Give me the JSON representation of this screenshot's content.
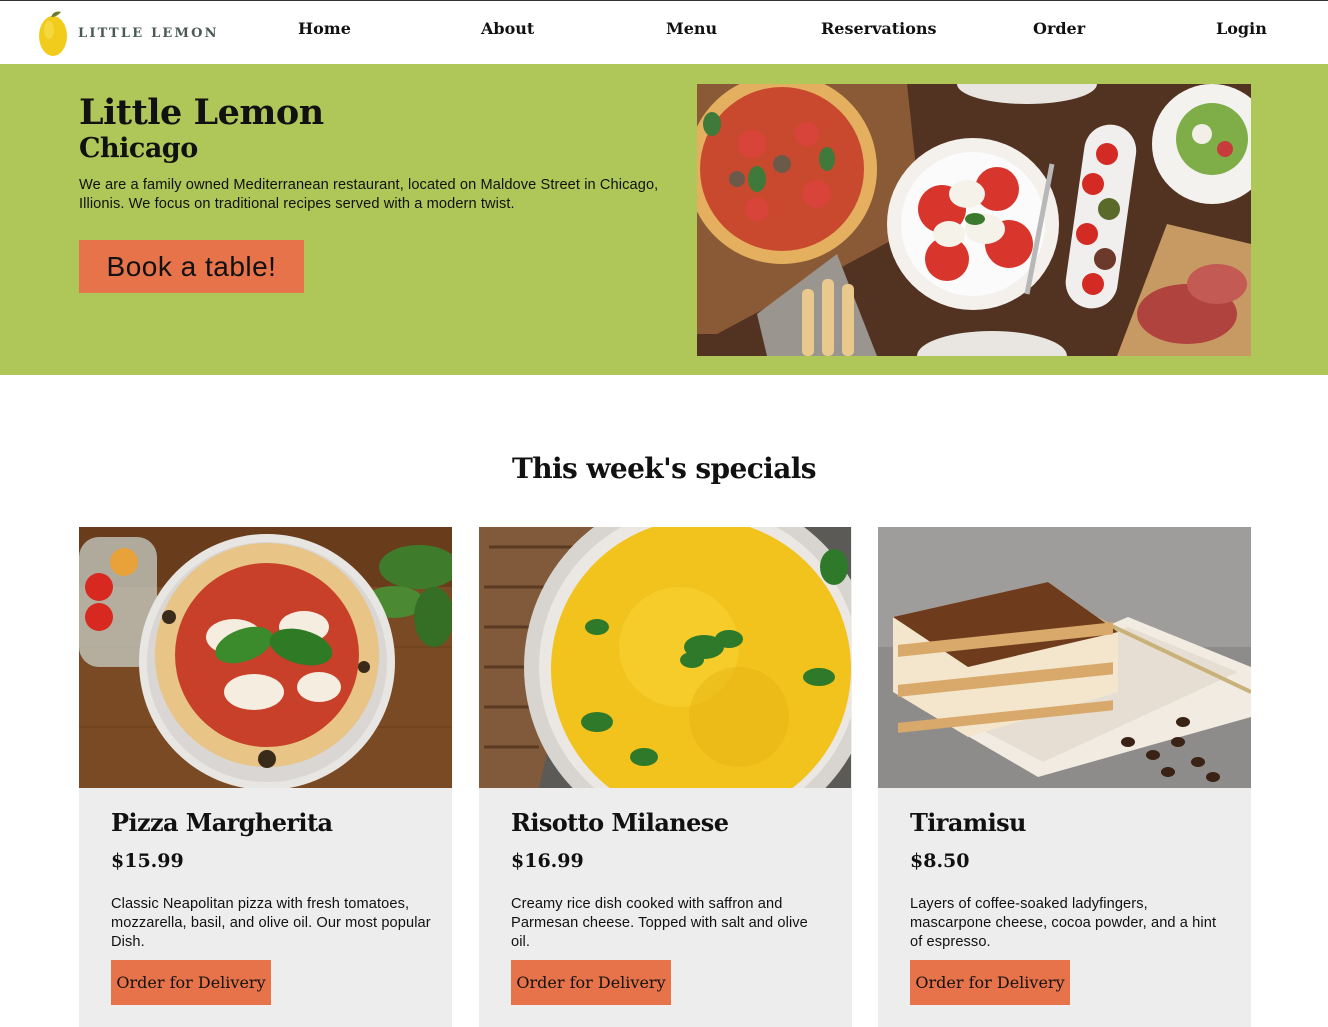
{
  "brand": {
    "logo_text": "LITTLE LEMON",
    "logo_alt": "Little Lemon logo"
  },
  "nav": {
    "items": [
      {
        "label": "Home"
      },
      {
        "label": "About"
      },
      {
        "label": "Menu"
      },
      {
        "label": "Reservations"
      },
      {
        "label": "Order"
      },
      {
        "label": "Login"
      }
    ]
  },
  "hero": {
    "title": "Little Lemon",
    "subtitle": "Chicago",
    "description": "We are a family owned Mediterranean restaurant, located on Maldove Street in Chicago, Illionis. We focus on traditional recipes served with a modern twist.",
    "button_label": "Book a table!",
    "image_alt": "Table with pizza, caprese salad, tomatoes and prosciutto"
  },
  "specials": {
    "title": "This week's specials",
    "cards": [
      {
        "name": "Pizza Margherita",
        "price": "$15.99",
        "description": "Classic Neapolitan pizza with fresh tomatoes, mozzarella, basil, and olive oil. Our most popular Dish.",
        "button_label": "Order for Delivery"
      },
      {
        "name": "Risotto Milanese",
        "price": "$16.99",
        "description": "Creamy rice dish cooked with saffron and Parmesan cheese. Topped with salt and olive oil.",
        "button_label": "Order for Delivery"
      },
      {
        "name": "Tiramisu",
        "price": "$8.50",
        "description": "Layers of coffee-soaked ladyfingers, mascarpone cheese, cocoa powder, and a hint of espresso.",
        "button_label": "Order for Delivery"
      }
    ]
  },
  "colors": {
    "hero_bg": "#afc759",
    "accent": "#e7734a",
    "card_bg": "#ededed",
    "logo_yellow": "#f2cc1c"
  }
}
